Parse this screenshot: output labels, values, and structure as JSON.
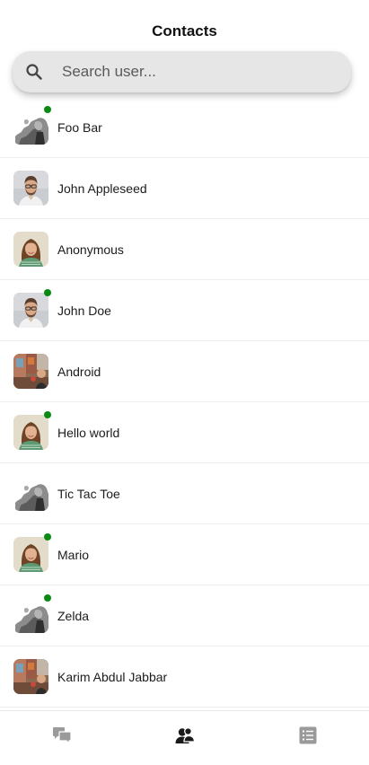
{
  "header": {
    "title": "Contacts"
  },
  "search": {
    "placeholder": "Search user...",
    "value": "",
    "icon": "search-icon"
  },
  "contacts": [
    {
      "name": "Foo Bar",
      "avatar": "blur",
      "online": true
    },
    {
      "name": "John Appleseed",
      "avatar": "man",
      "online": false
    },
    {
      "name": "Anonymous",
      "avatar": "woman",
      "online": false
    },
    {
      "name": "John Doe",
      "avatar": "man",
      "online": true
    },
    {
      "name": "Android",
      "avatar": "street",
      "online": false
    },
    {
      "name": "Hello world",
      "avatar": "woman",
      "online": true
    },
    {
      "name": "Tic Tac Toe",
      "avatar": "blur",
      "online": false
    },
    {
      "name": "Mario",
      "avatar": "woman",
      "online": true
    },
    {
      "name": "Zelda",
      "avatar": "blur",
      "online": true
    },
    {
      "name": "Karim Abdul Jabbar",
      "avatar": "street",
      "online": false
    }
  ],
  "tabbar": {
    "tabs": [
      {
        "icon": "chat-bubbles-icon",
        "active": false
      },
      {
        "icon": "contacts-icon",
        "active": true
      },
      {
        "icon": "list-icon",
        "active": false
      }
    ]
  },
  "colors": {
    "online": "#0a8a12",
    "search_bg": "#e6e6e6",
    "tab_inactive": "#9a9a9a",
    "tab_active": "#1a1a1a"
  }
}
